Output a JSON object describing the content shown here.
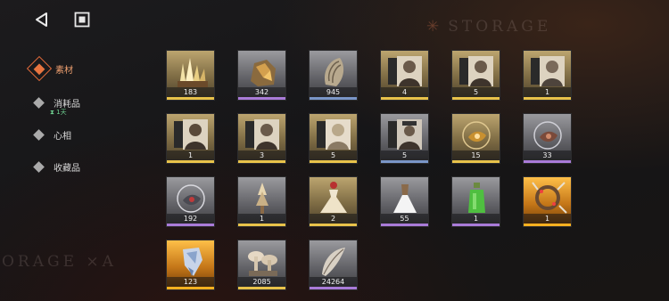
{
  "header": {
    "back_icon": "back-triangle-icon",
    "menu_icon": "stop-square-icon",
    "watermark_top": "STORAGE",
    "watermark_left": "ORAGE ×A"
  },
  "colors": {
    "accent": "#e8743f",
    "gold": "#e8c24a",
    "purple": "#a97bd8",
    "blue": "#7a96c8",
    "orange": "#ffb020",
    "green_tag": "#6fd090"
  },
  "sidebar": {
    "items": [
      {
        "label": "素材",
        "active": true
      },
      {
        "label": "消耗品",
        "sub": "⧗ 1天"
      },
      {
        "label": "心相"
      },
      {
        "label": "收藏品"
      }
    ]
  },
  "items": [
    {
      "count": "183",
      "icon": "crystal-cluster-icon",
      "rarity": "gold"
    },
    {
      "count": "342",
      "icon": "amber-ore-icon",
      "rarity": "purple"
    },
    {
      "count": "945",
      "icon": "shell-fragment-icon",
      "rarity": "blue"
    },
    {
      "count": "4",
      "icon": "portrait-film-icon",
      "rarity": "gold"
    },
    {
      "count": "5",
      "icon": "portrait-film-icon",
      "rarity": "gold"
    },
    {
      "count": "1",
      "icon": "portrait-film-icon",
      "rarity": "gold"
    },
    {
      "count": "1",
      "icon": "portrait-film-icon",
      "rarity": "gold"
    },
    {
      "count": "3",
      "icon": "portrait-film-icon",
      "rarity": "gold"
    },
    {
      "count": "5",
      "icon": "portrait-film-icon",
      "rarity": "gold"
    },
    {
      "count": "5",
      "icon": "portrait-film-icon",
      "rarity": "blue"
    },
    {
      "count": "15",
      "icon": "ornament-orb-icon",
      "rarity": "gold"
    },
    {
      "count": "33",
      "icon": "ornament-orb-icon",
      "rarity": "purple"
    },
    {
      "count": "192",
      "icon": "ornament-orb-icon",
      "rarity": "purple"
    },
    {
      "count": "1",
      "icon": "spire-figure-icon",
      "rarity": "gold"
    },
    {
      "count": "2",
      "icon": "dress-icon",
      "rarity": "gold"
    },
    {
      "count": "55",
      "icon": "dress-icon",
      "rarity": "purple"
    },
    {
      "count": "1",
      "icon": "potion-bottle-icon",
      "rarity": "purple"
    },
    {
      "count": "1",
      "icon": "antler-wreath-icon",
      "rarity": "orange"
    },
    {
      "count": "123",
      "icon": "ice-crystal-icon",
      "rarity": "orange"
    },
    {
      "count": "2085",
      "icon": "mushroom-cluster-icon",
      "rarity": "gold"
    },
    {
      "count": "24264",
      "icon": "feather-shard-icon",
      "rarity": "purple"
    }
  ]
}
